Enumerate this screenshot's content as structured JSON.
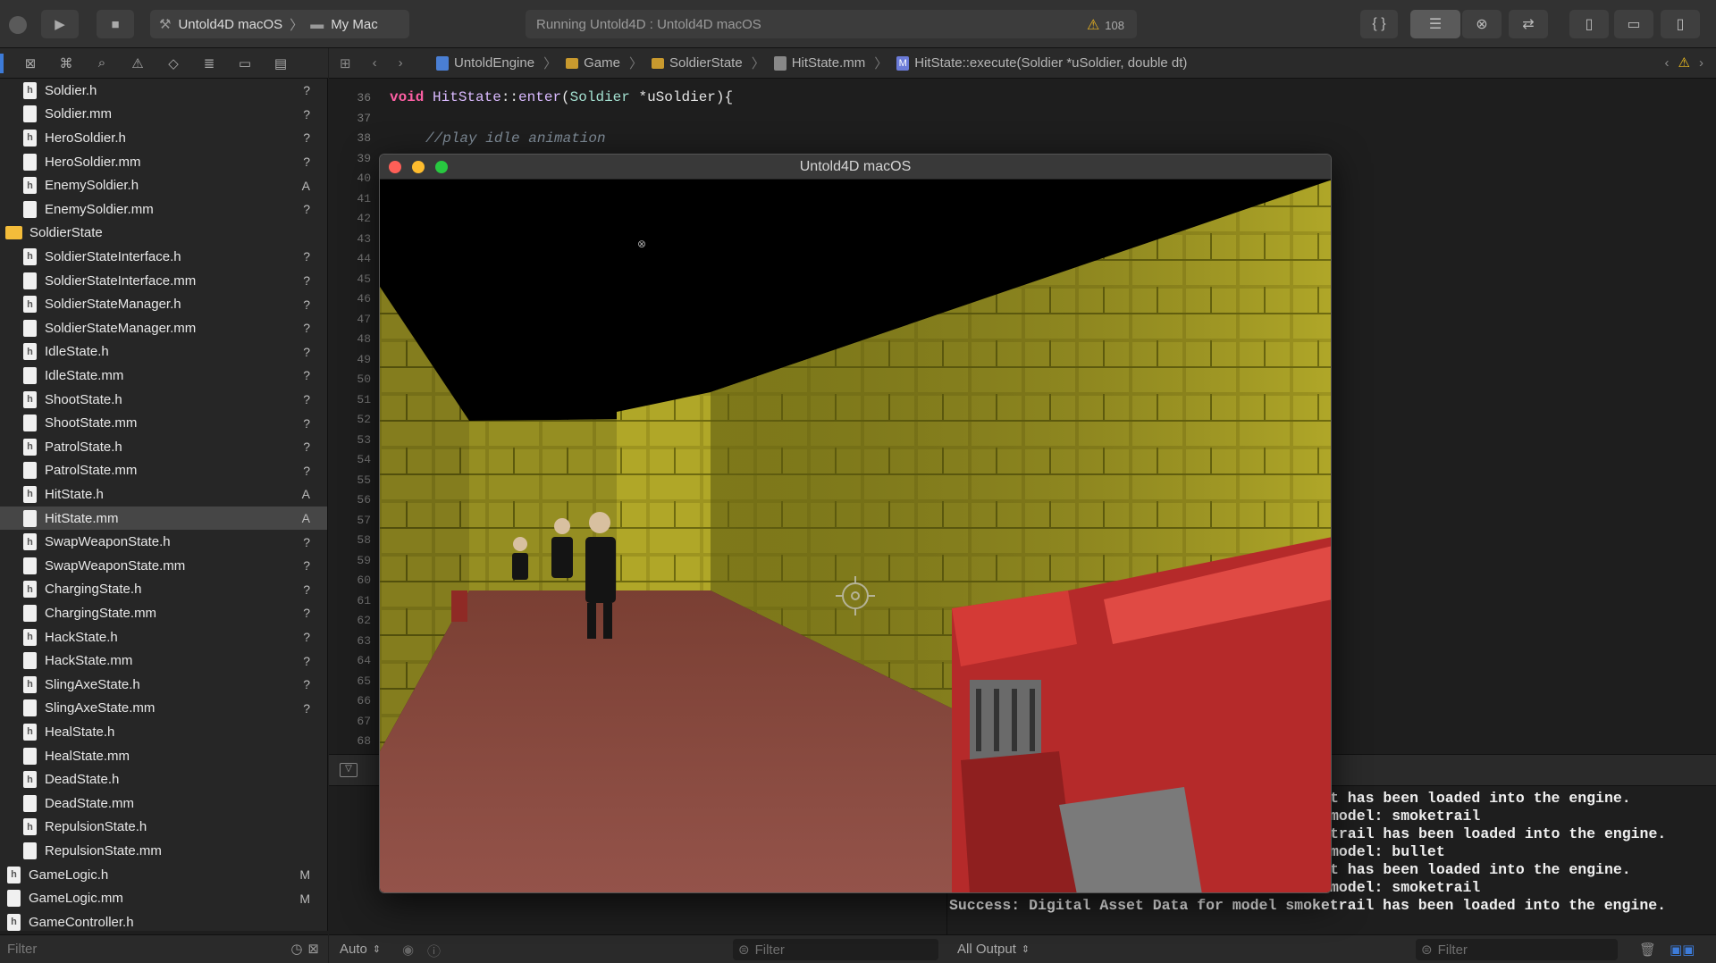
{
  "toolbar": {
    "scheme": "Untold4D macOS",
    "destination": "My Mac",
    "status_text": "Running Untold4D : Untold4D macOS",
    "warning_count": "108"
  },
  "jumpbar": {
    "crumbs": [
      "UntoldEngine",
      "Game",
      "SoldierState",
      "HitState.mm",
      "HitState::execute(Soldier *uSoldier, double dt)"
    ]
  },
  "navigator": {
    "items": [
      {
        "label": "Soldier.h",
        "badge": "?",
        "kind": "file",
        "icon": "h"
      },
      {
        "label": "Soldier.mm",
        "badge": "?",
        "kind": "file",
        "icon": ""
      },
      {
        "label": "HeroSoldier.h",
        "badge": "?",
        "kind": "file",
        "icon": "h"
      },
      {
        "label": "HeroSoldier.mm",
        "badge": "?",
        "kind": "file",
        "icon": ""
      },
      {
        "label": "EnemySoldier.h",
        "badge": "A",
        "kind": "file",
        "icon": "h"
      },
      {
        "label": "EnemySoldier.mm",
        "badge": "?",
        "kind": "file",
        "icon": ""
      },
      {
        "label": "SoldierState",
        "badge": "",
        "kind": "folder",
        "icon": ""
      },
      {
        "label": "SoldierStateInterface.h",
        "badge": "?",
        "kind": "file",
        "icon": "h"
      },
      {
        "label": "SoldierStateInterface.mm",
        "badge": "?",
        "kind": "file",
        "icon": ""
      },
      {
        "label": "SoldierStateManager.h",
        "badge": "?",
        "kind": "file",
        "icon": "h"
      },
      {
        "label": "SoldierStateManager.mm",
        "badge": "?",
        "kind": "file",
        "icon": ""
      },
      {
        "label": "IdleState.h",
        "badge": "?",
        "kind": "file",
        "icon": "h"
      },
      {
        "label": "IdleState.mm",
        "badge": "?",
        "kind": "file",
        "icon": ""
      },
      {
        "label": "ShootState.h",
        "badge": "?",
        "kind": "file",
        "icon": "h"
      },
      {
        "label": "ShootState.mm",
        "badge": "?",
        "kind": "file",
        "icon": ""
      },
      {
        "label": "PatrolState.h",
        "badge": "?",
        "kind": "file",
        "icon": "h"
      },
      {
        "label": "PatrolState.mm",
        "badge": "?",
        "kind": "file",
        "icon": ""
      },
      {
        "label": "HitState.h",
        "badge": "A",
        "kind": "file",
        "icon": "h"
      },
      {
        "label": "HitState.mm",
        "badge": "A",
        "kind": "file",
        "icon": "",
        "selected": true
      },
      {
        "label": "SwapWeaponState.h",
        "badge": "?",
        "kind": "file",
        "icon": "h"
      },
      {
        "label": "SwapWeaponState.mm",
        "badge": "?",
        "kind": "file",
        "icon": ""
      },
      {
        "label": "ChargingState.h",
        "badge": "?",
        "kind": "file",
        "icon": "h"
      },
      {
        "label": "ChargingState.mm",
        "badge": "?",
        "kind": "file",
        "icon": ""
      },
      {
        "label": "HackState.h",
        "badge": "?",
        "kind": "file",
        "icon": "h"
      },
      {
        "label": "HackState.mm",
        "badge": "?",
        "kind": "file",
        "icon": ""
      },
      {
        "label": "SlingAxeState.h",
        "badge": "?",
        "kind": "file",
        "icon": "h"
      },
      {
        "label": "SlingAxeState.mm",
        "badge": "?",
        "kind": "file",
        "icon": ""
      },
      {
        "label": "HealState.h",
        "badge": "",
        "kind": "file",
        "icon": "h"
      },
      {
        "label": "HealState.mm",
        "badge": "",
        "kind": "file",
        "icon": ""
      },
      {
        "label": "DeadState.h",
        "badge": "",
        "kind": "file",
        "icon": "h"
      },
      {
        "label": "DeadState.mm",
        "badge": "",
        "kind": "file",
        "icon": ""
      },
      {
        "label": "RepulsionState.h",
        "badge": "",
        "kind": "file",
        "icon": "h"
      },
      {
        "label": "RepulsionState.mm",
        "badge": "",
        "kind": "file",
        "icon": ""
      },
      {
        "label": "GameLogic.h",
        "badge": "M",
        "kind": "file",
        "icon": "h",
        "outdent": true
      },
      {
        "label": "GameLogic.mm",
        "badge": "M",
        "kind": "file",
        "icon": "",
        "outdent": true
      },
      {
        "label": "GameController.h",
        "badge": "",
        "kind": "file",
        "icon": "h",
        "outdent": true
      }
    ],
    "filter_placeholder": "Filter"
  },
  "editor": {
    "line_numbers": [
      "36",
      "37",
      "38",
      "39",
      "40",
      "41",
      "42",
      "43",
      "44",
      "45",
      "46",
      "47",
      "48",
      "49",
      "50",
      "51",
      "52",
      "53",
      "54",
      "55",
      "56",
      "57",
      "58",
      "59",
      "60",
      "61",
      "62",
      "63",
      "64",
      "65",
      "66",
      "67",
      "68"
    ],
    "line36": {
      "kw": "void",
      "cls": "HitState",
      "sep": "::",
      "fn": "enter",
      "open": "(",
      "type": "Soldier",
      "rest": " *uSoldier){"
    },
    "line38": "//play idle animation"
  },
  "game_window": {
    "title": "Untold4D macOS"
  },
  "console": {
    "lines": [
      "t has been loaded into the engine.",
      "model: smoketrail",
      "trail has been loaded into the engine.",
      "model: bullet",
      "t has been loaded into the engine.",
      "model: smoketrail",
      "Success: Digital Asset Data for model smoketrail has been loaded into the engine."
    ]
  },
  "bottom": {
    "auto_label": "Auto",
    "vars_filter": "Filter",
    "output_label": "All Output",
    "console_filter": "Filter"
  },
  "colors": {
    "accent": "#3d7bd8",
    "warning": "#e9b320",
    "close": "#ff5f57",
    "minimize": "#febc2e",
    "zoom": "#28c840",
    "wall": "#a8a020",
    "floor": "#8a4a3c",
    "gun": "#b52a2a"
  }
}
